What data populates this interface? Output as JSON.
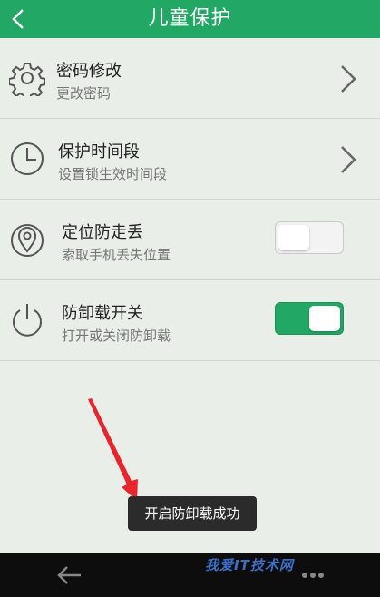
{
  "header": {
    "title": "儿童保护",
    "back_icon": "chevron-left-icon"
  },
  "rows": [
    {
      "title": "密码修改",
      "subtitle": "更改密码",
      "icon": "gear-icon",
      "control": "chevron"
    },
    {
      "title": "保护时间段",
      "subtitle": "设置锁生效时间段",
      "icon": "clock-icon",
      "control": "chevron"
    },
    {
      "title": "定位防走丢",
      "subtitle": "索取手机丢失位置",
      "icon": "location-pin-icon",
      "control": "toggle",
      "on": false
    },
    {
      "title": "防卸载开关",
      "subtitle": "打开或关闭防卸载",
      "icon": "power-icon",
      "control": "toggle",
      "on": true
    }
  ],
  "toast": {
    "text": "开启防卸载成功"
  },
  "watermark": {
    "text": "我爱IT技术网"
  },
  "colors": {
    "accent": "#22a864",
    "background": "#e9efe8",
    "annotation_arrow": "#e8242c"
  }
}
